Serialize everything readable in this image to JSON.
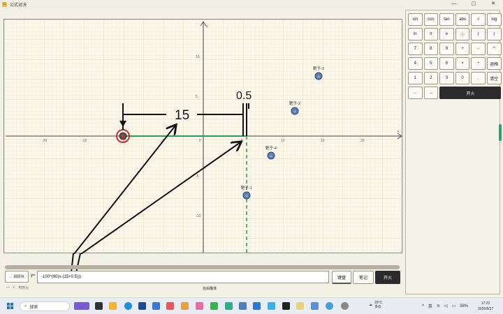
{
  "titlebar": {
    "title": "公式对决",
    "app_icon": "公"
  },
  "window_controls": {
    "minimize": "—",
    "maximize": "▢",
    "close": "✕"
  },
  "graph": {
    "axis_labels": {
      "x": "x",
      "y": "y"
    },
    "x_ticks": [
      "-20",
      "-15",
      "-10",
      "-5",
      "0",
      "5",
      "10",
      "15",
      "20"
    ],
    "y_ticks": [
      "10",
      "5",
      "0",
      "-5",
      "-10"
    ],
    "targets": [
      {
        "label": "靶子-3"
      },
      {
        "label": "靶子-2"
      },
      {
        "label": "靶子-4"
      },
      {
        "label": "靶子-1"
      }
    ],
    "annotations": {
      "distance": "15",
      "offset": "0.5"
    }
  },
  "keypad": {
    "rows": [
      [
        "sin",
        "cos",
        "tan",
        "abs",
        "√",
        "log"
      ],
      [
        "ln",
        "π",
        "e",
        "ⓧ",
        "(",
        ")"
      ],
      [
        "7",
        "8",
        "9",
        "+",
        "−",
        "^"
      ],
      [
        "4",
        "5",
        "6",
        "×",
        "÷",
        "退格"
      ],
      [
        "1",
        "2",
        "3",
        "0",
        ".",
        "清空"
      ]
    ],
    "left_arrow": "←",
    "right_arrow": "→",
    "fire": "开火"
  },
  "formula_bar": {
    "back_label": "← 跳跃块",
    "y_label": "y=",
    "value": "-100^(80(x-(15+0.5)))",
    "keyboard_label": "键盘",
    "notes_label": "笔记",
    "fire_label": "开火",
    "status_minus": "—",
    "status_check": "✓",
    "status_text": "可开火",
    "aim_text": "自由瞄准"
  },
  "taskbar": {
    "search_placeholder": "搜索",
    "weather_temp": "29°C",
    "weather_desc": "多云",
    "ime": "英",
    "battery": "38%",
    "time": "17:22",
    "date": "2026/8/27"
  },
  "colors": {
    "accent_green": "#2aa070",
    "dashed_line": "#2e9a5c",
    "target_ring": "#d03030",
    "target_fill": "#5b7fb3"
  }
}
